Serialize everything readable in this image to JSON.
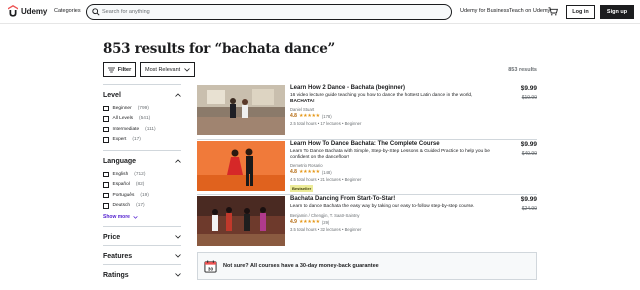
{
  "header": {
    "logo_text": "Udemy",
    "categories": "Categories",
    "search_placeholder": "Search for anything",
    "business": "Udemy for Business",
    "teach": "Teach on Udemy",
    "login": "Log in",
    "signup": "Sign up"
  },
  "page_title": "853 results for “bachata dance”",
  "toolbar": {
    "filter_label": "Filter",
    "sort_label": "Most Relevant",
    "results_count": "853 results"
  },
  "sidebar": {
    "level": {
      "title": "Level",
      "options": [
        {
          "label": "Beginner",
          "count": "(799)"
        },
        {
          "label": "All Levels",
          "count": "(541)"
        },
        {
          "label": "Intermediate",
          "count": "(111)"
        },
        {
          "label": "Expert",
          "count": "(17)"
        }
      ]
    },
    "language": {
      "title": "Language",
      "options": [
        {
          "label": "English",
          "count": "(712)"
        },
        {
          "label": "Español",
          "count": "(82)"
        },
        {
          "label": "Português",
          "count": "(19)"
        },
        {
          "label": "Deutsch",
          "count": "(17)"
        }
      ],
      "show_more": "Show more"
    },
    "price": {
      "title": "Price"
    },
    "features": {
      "title": "Features"
    },
    "ratings": {
      "title": "Ratings"
    }
  },
  "courses": [
    {
      "title": "Learn How 2 Dance - Bachata (beginner)",
      "desc_line1": "16 video lecture guide teaching you how to dance the hottest Latin dance in the world,",
      "desc_line2": "BACHATA!",
      "author": "Daniel Stuart",
      "rating": "4.8",
      "stars": "★★★★★",
      "reviews": "(178)",
      "meta": "2.5 total hours • 17 lectures • Beginner",
      "price": "$9.99",
      "old_price": "$19.99"
    },
    {
      "title": "Learn How To Dance Bachata: The Complete Course",
      "desc_line1": "Learn To Dance Bachata with Simple, Step-by-Step Lessons & Guided Practice to help you be",
      "desc_line2": "confident on the dancefloor!",
      "author": "Demetrio Rosario",
      "rating": "4.8",
      "stars": "★★★★★",
      "reviews": "(148)",
      "meta": "4.5 total hours • 21 lectures • Beginner",
      "badge": "Bestseller",
      "price": "$9.99",
      "old_price": "$49.99"
    },
    {
      "title": "Bachata Dancing From Start-To-Star!",
      "desc_line1": "Learn to dance Bachata the easy way by taking our easy to-follow step-by-step course.",
      "author": "Benjamin / Chengjin, T. Saatr-Saintny",
      "rating": "4.9",
      "stars": "★★★★★",
      "reviews": "(29)",
      "meta": "3.5 total hours • 32 lectures • Beginner",
      "price": "$9.99",
      "old_price": "$24.99"
    }
  ],
  "guarantee": "Not sure? All courses have a 30-day money-back guarantee",
  "colors": {
    "brand": "#ec5252",
    "signup_bg": "#1c1d1f",
    "link": "#5624d0",
    "rating": "#b4690e",
    "stars": "#e59819",
    "bestseller": "#eceb98"
  }
}
